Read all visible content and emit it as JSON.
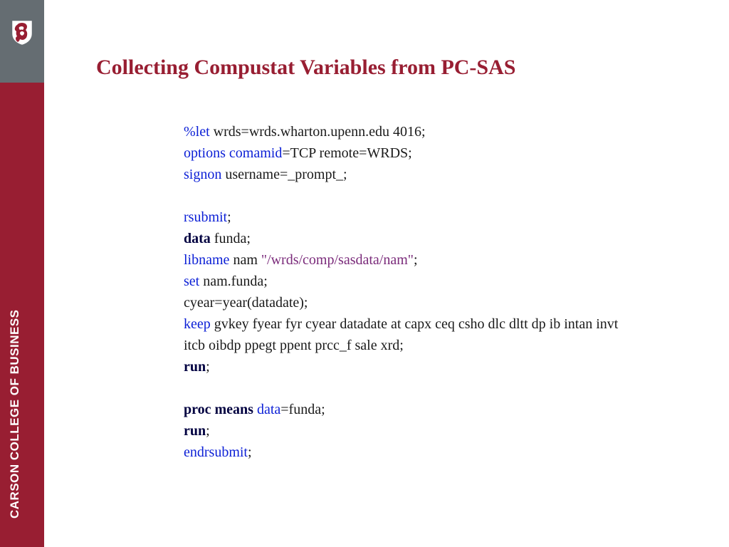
{
  "sidebar": {
    "vertical_label": "CARSON COLLEGE OF BUSINESS"
  },
  "title": "Collecting Compustat Variables from PC-SAS",
  "code": {
    "l1_kw": "%let",
    "l1_rest": " wrds=wrds.wharton.upenn.edu 4016;",
    "l2_kw": "options comamid",
    "l2_rest": "=TCP remote=WRDS;",
    "l3_kw": "signon",
    "l3_rest": " username=_prompt_;",
    "l5_kw": "rsubmit",
    "l5_rest": ";",
    "l6_kw": "data",
    "l6_rest": " funda;",
    "l7_kw": "libname",
    "l7_mid": " nam ",
    "l7_str": "\"/wrds/comp/sasdata/nam\"",
    "l7_end": ";",
    "l8_kw": "set",
    "l8_rest": " nam.funda;",
    "l9": "cyear=year(datadate);",
    "l10_kw": "keep",
    "l10_rest": " gvkey fyear fyr cyear datadate at capx ceq csho dlc dltt dp ib intan invt itcb oibdp ppegt ppent prcc_f sale xrd;",
    "l11_kw": "run",
    "l11_rest": ";",
    "l13_kw": "proc means",
    "l13_kw2": " data",
    "l13_rest": "=funda;",
    "l14_kw": "run",
    "l14_rest": ";",
    "l15_kw": "endrsubmit",
    "l15_rest": ";"
  }
}
